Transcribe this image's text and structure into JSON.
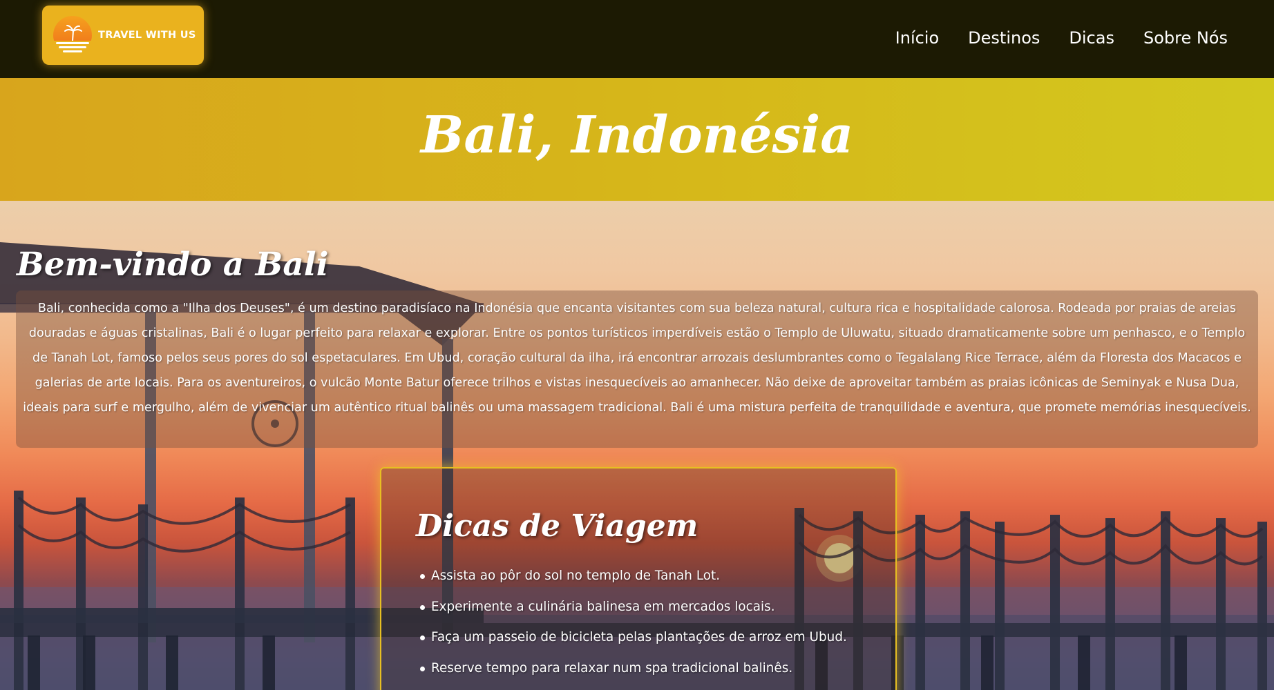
{
  "header": {
    "logo_text": "TRAVEL WITH US",
    "logo_icon": "sunset-palm-icon",
    "nav": [
      {
        "label": "Início"
      },
      {
        "label": "Destinos"
      },
      {
        "label": "Dicas"
      },
      {
        "label": "Sobre Nós"
      }
    ]
  },
  "hero": {
    "title": "Bali, Indonésia"
  },
  "welcome": {
    "heading": "Bem-vindo a Bali",
    "paragraph": "Bali, conhecida como a \"Ilha dos Deuses\", é um destino paradisíaco na Indonésia que encanta visitantes com sua beleza natural, cultura rica e hospitalidade calorosa. Rodeada por praias de areias douradas e águas cristalinas, Bali é o lugar perfeito para relaxar e explorar. Entre os pontos turísticos imperdíveis estão o Templo de Uluwatu, situado dramaticamente sobre um penhasco, e o Templo de Tanah Lot, famoso pelos seus pores do sol espetaculares. Em Ubud, coração cultural da ilha, irá encontrar arrozais deslumbrantes como o Tegalalang Rice Terrace, além da Floresta dos Macacos e galerias de arte locais. Para os aventureiros, o vulcão Monte Batur oferece trilhos e vistas inesquecíveis ao amanhecer. Não deixe de aproveitar também as praias icônicas de Seminyak e Nusa Dua, ideais para surf e mergulho, além de vivenciar um autêntico ritual balinês ou uma massagem tradicional. Bali é uma mistura perfeita de tranquilidade e aventura, que promete memórias inesquecíveis."
  },
  "tips": {
    "heading": "Dicas de Viagem",
    "items": [
      "Assista ao pôr do sol no templo de Tanah Lot.",
      "Experimente a culinária balinesa em mercados locais.",
      "Faça um passeio de bicicleta pelas plantações de arroz em Ubud.",
      "Reserve tempo para relaxar num spa tradicional balinês."
    ]
  },
  "colors": {
    "topbar": "#1c1a03",
    "logo_bg": "#eab21e",
    "hero_band": "#d6b81a",
    "tips_border": "#e7bf22"
  }
}
